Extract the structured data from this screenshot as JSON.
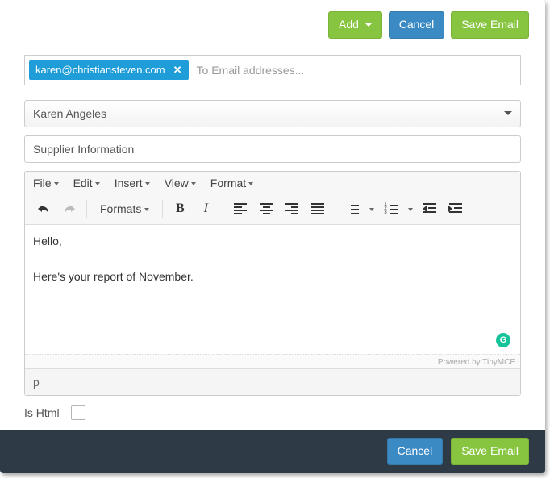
{
  "topButtons": {
    "add": "Add",
    "cancel": "Cancel",
    "save": "Save Email"
  },
  "to": {
    "chip": "karen@christiansteven.com",
    "placeholder": "To Email addresses..."
  },
  "from": {
    "selected": "Karen Angeles"
  },
  "subject": "Supplier Information",
  "menubar": {
    "file": "File",
    "edit": "Edit",
    "insert": "Insert",
    "view": "View",
    "format": "Format"
  },
  "toolbar": {
    "formats": "Formats"
  },
  "body": {
    "line1": "Hello,",
    "line2": "Here's your report of November."
  },
  "powered": "Powered by TinyMCE",
  "statusbar": "p",
  "isHtmlLabel": "Is Html",
  "bottomButtons": {
    "cancel": "Cancel",
    "save": "Save Email"
  }
}
